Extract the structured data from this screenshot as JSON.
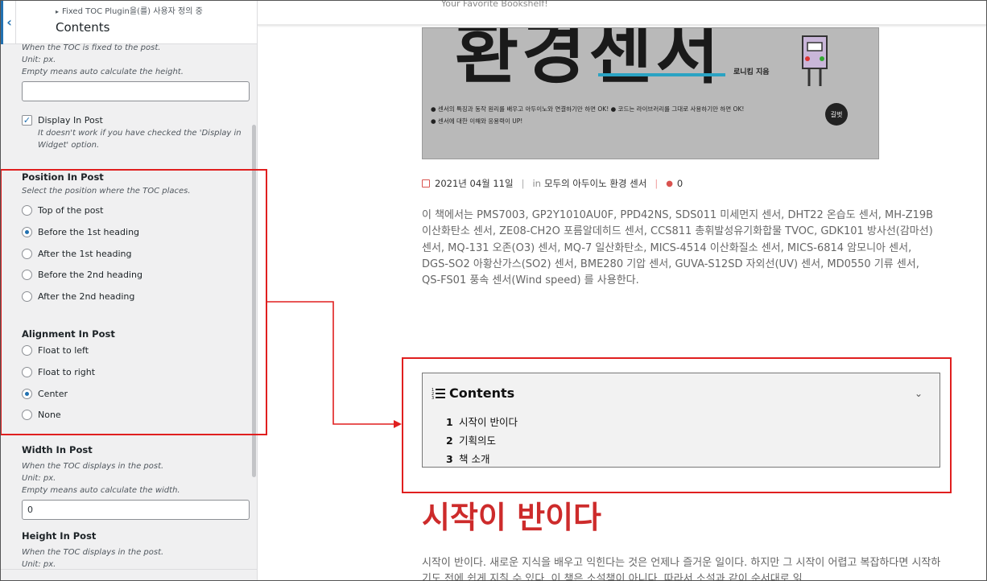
{
  "sidebar": {
    "breadcrumb": "Fixed TOC Plugin을(를) 사용자 정의 중",
    "section_title": "Contents",
    "height_fixed_desc": [
      "When the TOC is fixed to the post.",
      "Unit: px.",
      "Empty means auto calculate the height."
    ],
    "height_fixed_value": "",
    "display_in_post": {
      "label": "Display In Post",
      "checked": true,
      "desc": [
        "It doesn't work if you have checked the 'Display in",
        "Widget' option."
      ]
    },
    "position_in_post": {
      "label": "Position In Post",
      "desc": "Select the position where the TOC places.",
      "options": [
        "Top of the post",
        "Before the 1st heading",
        "After the 1st heading",
        "Before the 2nd heading",
        "After the 2nd heading"
      ],
      "selected": "Before the 1st heading"
    },
    "alignment_in_post": {
      "label": "Alignment In Post",
      "options": [
        "Float to left",
        "Float to right",
        "Center",
        "None"
      ],
      "selected": "Center"
    },
    "width_in_post": {
      "label": "Width In Post",
      "desc": [
        "When the TOC displays in the post.",
        "Unit: px.",
        "Empty means auto calculate the width."
      ],
      "value": "0"
    },
    "height_in_post": {
      "label": "Height In Post",
      "desc": [
        "When the TOC displays in the post.",
        "Unit: px."
      ]
    }
  },
  "preview": {
    "tagline": "Your Favorite Bookshelf!",
    "cover": {
      "title": "환경센서",
      "author": "로니킴 지음",
      "line1": "● 센서의 특징과 동작 원리를 배우고 아두이노와 연결하기만 하면 OK!  ● 코드는 라이브러리를 그대로 사용하기만 하면 OK!",
      "line2": "● 센서에 대한 이해와 응용력이 UP!",
      "publisher": "길벗"
    },
    "meta": {
      "date": "2021년 04월 11일",
      "in_label": "in",
      "category": "모두의 아두이노 환경 센서",
      "comments": "0"
    },
    "intro": "이 책에서는 PMS7003, GP2Y1010AU0F, PPD42NS, SDS011 미세먼지 센서, DHT22 온습도 센서, MH-Z19B 이산화탄소 센서, ZE08-CH2O 포름알데히드 센서, CCS811 총휘발성유기화합물 TVOC, GDK101 방사선(감마선) 센서, MQ-131 오존(O3) 센서, MQ-7 일산화탄소, MICS-4514 이산화질소 센서, MICS-6814 암모니아 센서, DGS-SO2 아황산가스(SO2) 센서, BME280 기압 센서, GUVA-S12SD 자외선(UV) 센서, MD0550 기류 센서, QS-FS01 풍속 센서(Wind speed) 를 사용한다.",
    "toc": {
      "title": "Contents",
      "items": [
        {
          "num": "1",
          "text": "시작이 반이다"
        },
        {
          "num": "2",
          "text": "기획의도"
        },
        {
          "num": "3",
          "text": "책 소개"
        }
      ]
    },
    "heading1": "시작이 반이다",
    "body": "시작이 반이다. 새로운 지식을 배우고 익힌다는 것은 언제나 즐거운 일이다. 하지만 그 시작이 어렵고 복잡하다면 시작하기도 전에 쉽게 지칠 수 있다. 이 책은 소설책이 아니다. 따라서 소설과 같이 순서대로 읽"
  },
  "colors": {
    "accent": "#2271b1",
    "annotation": "#e01f1f",
    "heading": "#cd2b2b"
  }
}
